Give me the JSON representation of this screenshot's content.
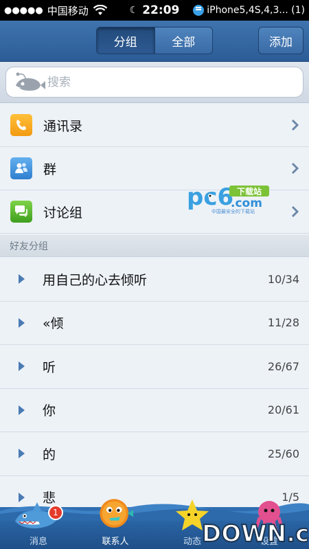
{
  "status_bar": {
    "carrier": "中国移动",
    "time": "22:09",
    "notification": "iPhone5,4S,4,3... (1)"
  },
  "nav": {
    "segments": [
      {
        "label": "分组",
        "active": true
      },
      {
        "label": "全部",
        "active": false
      }
    ],
    "add_label": "添加"
  },
  "search": {
    "placeholder": "搜索"
  },
  "menu": [
    {
      "label": "通讯录",
      "icon": "phone-icon",
      "color": "#f5a623"
    },
    {
      "label": "群",
      "icon": "group-icon",
      "color": "#3d8edb"
    },
    {
      "label": "讨论组",
      "icon": "chat-icon",
      "color": "#5dbb2f"
    }
  ],
  "section_header": "好友分组",
  "groups": [
    {
      "name": "用自己的心去倾听",
      "count": "10/34"
    },
    {
      "name": "«倾",
      "count": "11/28"
    },
    {
      "name": "听",
      "count": "26/67"
    },
    {
      "name": "你",
      "count": "20/61"
    },
    {
      "name": "的",
      "count": "25/60"
    },
    {
      "name": "悲",
      "count": "1/5"
    }
  ],
  "tabs": [
    {
      "label": "消息",
      "badge": "1"
    },
    {
      "label": "联系人",
      "active": true
    },
    {
      "label": "动态"
    },
    {
      "label": "设置"
    }
  ],
  "watermarks": {
    "pc6_logo": "pc6",
    "pc6_sub": "下载站",
    "pc6_domain": ".com",
    "pc6_tagline": "中国最安全的下载站",
    "down_logo": "DOWN.cc"
  }
}
